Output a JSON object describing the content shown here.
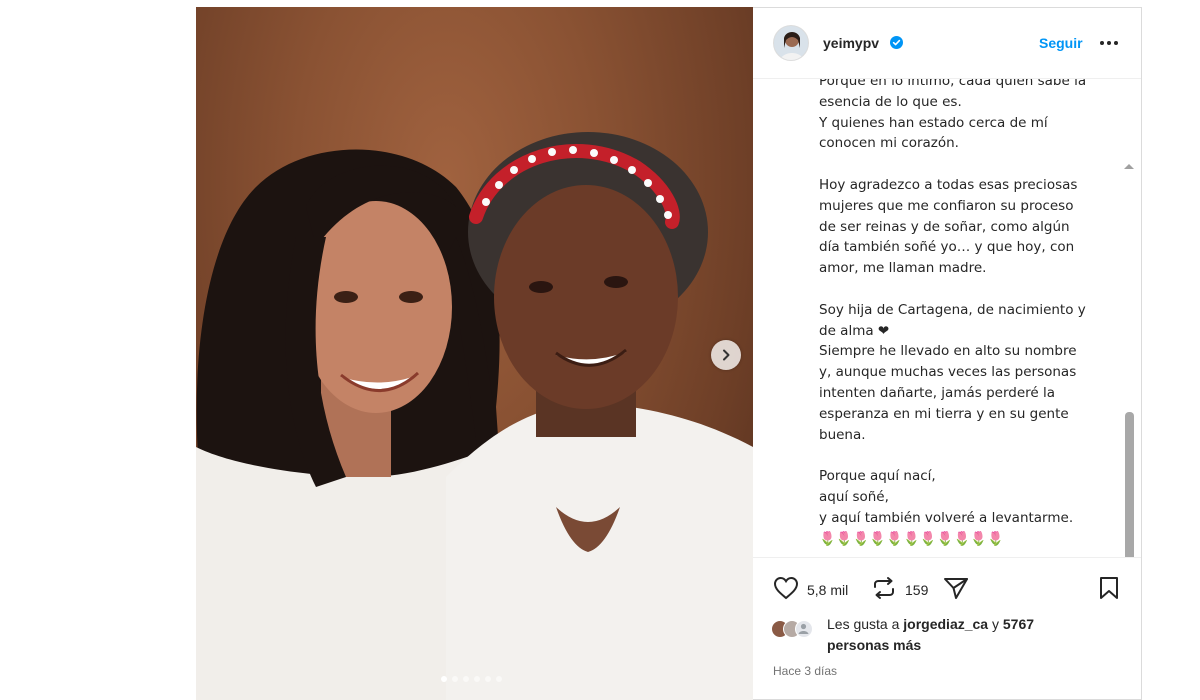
{
  "post": {
    "image_alt": "Two women smiling together",
    "carousel_count": 6,
    "carousel_active": 0
  },
  "header": {
    "username": "yeimypv",
    "verified_icon": "verified-badge-icon",
    "follow_label": "Seguir",
    "more_icon": "more-horizontal-icon"
  },
  "caption": {
    "text": "Porque en lo íntimo, cada quien sabe la\nesencia de lo que es.\nY quienes han estado cerca de mí\nconocen mi corazón.\n\nHoy agradezco a todas esas preciosas\nmujeres que me confiaron su proceso\nde ser reinas y de soñar, como algún\ndía también soñé yo… y que hoy, con\namor, me llaman madre.\n\nSoy hija de Cartagena, de nacimiento y\nde alma ❤\nSiempre he llevado en alto su nombre\ny, aunque muchas veces las personas\nintenten dañarte, jamás perderé la\nesperanza en mi tierra y en su gente\nbuena.\n\nPorque aquí nací,\naquí soñé,\ny aquí también volveré a levantarme.\n🌷🌷🌷🌷🌷🌷🌷🌷🌷🌷🌷"
  },
  "actions": {
    "like_count": "5,8 mil",
    "repost_count": "159"
  },
  "likes": {
    "prefix": "Les gusta a",
    "user": "jorgediaz_ca",
    "connector": "y",
    "others": "5767",
    "suffix": "personas más"
  },
  "timestamp": "Hace 3 días",
  "colors": {
    "accent": "#0095f6",
    "heart": "#e0245e",
    "text": "#262626",
    "muted": "#737373"
  }
}
